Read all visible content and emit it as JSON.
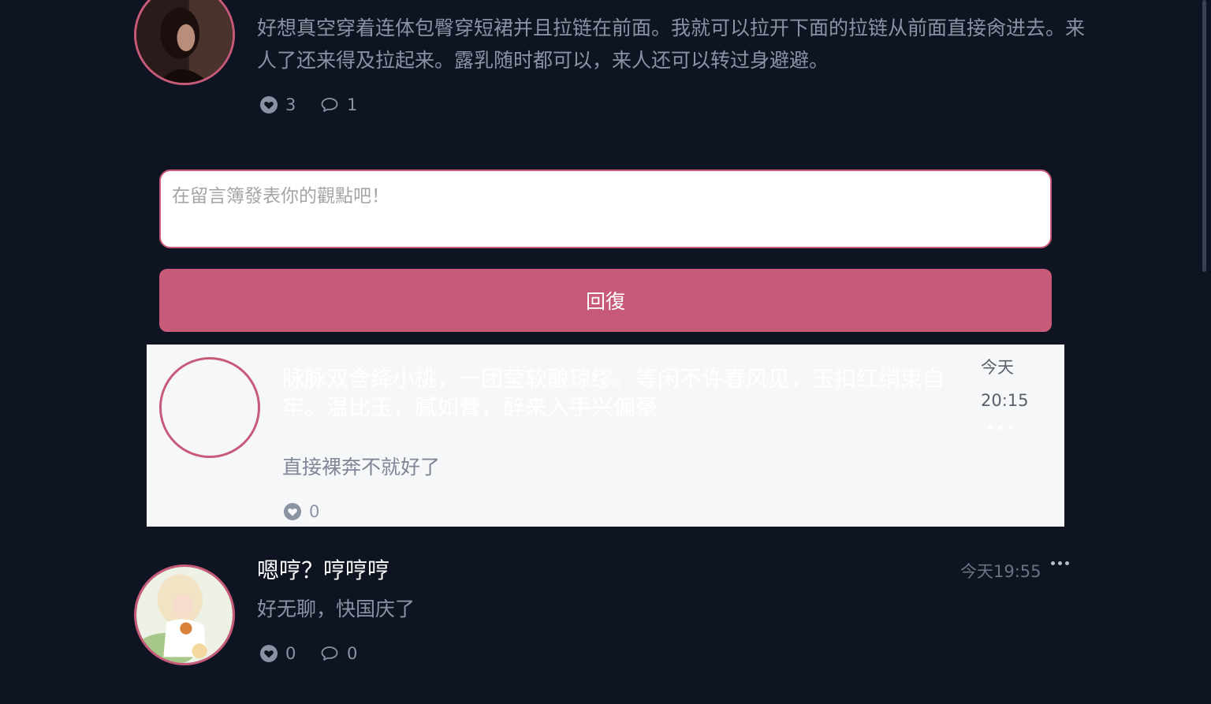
{
  "top_post": {
    "text": "好想真空穿着连体包臀穿短裙并且拉链在前面。我就可以拉开下面的拉链从前面直接肏进去。来人了还来得及拉起来。露乳随时都可以，来人还可以转过身避避。",
    "likes": "3",
    "comments": "1"
  },
  "reply_form": {
    "placeholder": "在留言簿發表你的觀點吧！",
    "submit_label": "回復"
  },
  "reply": {
    "ghost_text": "脉脉双含绛小桃，一团莹软酿琼缪。等闲不许春风见，玉扣红绡束自牢。温比玉，腻如膏，醉来入手兴偏豪",
    "date_day": "今天",
    "date_time": "20:15",
    "more": "•••",
    "text": "直接裸奔不就好了",
    "likes": "0"
  },
  "bottom_post": {
    "username": "嗯哼？哼哼哼",
    "timestamp": "今天19:55",
    "text": "好无聊，快国庆了",
    "likes": "0",
    "comments": "0"
  },
  "colors": {
    "background": "#0f1422",
    "accent": "#c85a79",
    "muted_text": "#8b93a3"
  },
  "icons": [
    "heart-icon",
    "comment-icon",
    "more-icon"
  ]
}
